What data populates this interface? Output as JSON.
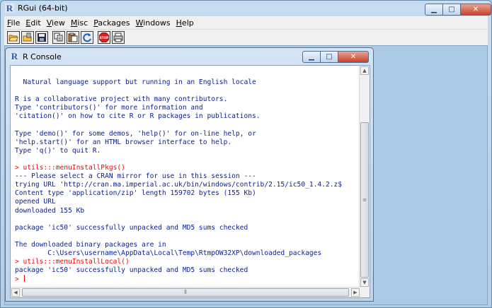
{
  "app": {
    "title": "RGui (64-bit)",
    "icon": "r-logo-icon",
    "brand_color": "#2a5fb0"
  },
  "menu": [
    {
      "label": "File",
      "mnemonic": "F",
      "rest": "ile"
    },
    {
      "label": "Edit",
      "mnemonic": "E",
      "rest": "dit"
    },
    {
      "label": "View",
      "mnemonic": "V",
      "rest": "iew"
    },
    {
      "label": "Misc",
      "mnemonic": "M",
      "rest": "isc"
    },
    {
      "label": "Packages",
      "mnemonic": "P",
      "rest": "ackages"
    },
    {
      "label": "Windows",
      "mnemonic": "W",
      "rest": "indows"
    },
    {
      "label": "Help",
      "mnemonic": "H",
      "rest": "elp"
    }
  ],
  "toolbar": [
    "open-script-icon",
    "load-workspace-icon",
    "save-workspace-icon",
    "copy-icon",
    "paste-icon",
    "copy-paste-icon",
    "stop-icon",
    "print-icon"
  ],
  "toolbar_stop_text": "STOP",
  "console": {
    "title": "R Console",
    "lines": [
      {
        "text": "",
        "cmd": false
      },
      {
        "text": "  Natural language support but running in an English locale",
        "cmd": false
      },
      {
        "text": "",
        "cmd": false
      },
      {
        "text": "R is a collaborative project with many contributors.",
        "cmd": false
      },
      {
        "text": "Type 'contributors()' for more information and",
        "cmd": false
      },
      {
        "text": "'citation()' on how to cite R or R packages in publications.",
        "cmd": false
      },
      {
        "text": "",
        "cmd": false
      },
      {
        "text": "Type 'demo()' for some demos, 'help()' for on-line help, or",
        "cmd": false
      },
      {
        "text": "'help.start()' for an HTML browser interface to help.",
        "cmd": false
      },
      {
        "text": "Type 'q()' to quit R.",
        "cmd": false
      },
      {
        "text": "",
        "cmd": false
      },
      {
        "text": "> utils:::menuInstallPkgs()",
        "cmd": true
      },
      {
        "text": "--- Please select a CRAN mirror for use in this session ---",
        "cmd": false
      },
      {
        "text": "trying URL 'http://cran.ma.imperial.ac.uk/bin/windows/contrib/2.15/ic50_1.4.2.z$",
        "cmd": false
      },
      {
        "text": "Content type 'application/zip' length 159702 bytes (155 Kb)",
        "cmd": false
      },
      {
        "text": "opened URL",
        "cmd": false
      },
      {
        "text": "downloaded 155 Kb",
        "cmd": false
      },
      {
        "text": "",
        "cmd": false
      },
      {
        "text": "package 'ic50' successfully unpacked and MD5 sums checked",
        "cmd": false
      },
      {
        "text": "",
        "cmd": false
      },
      {
        "text": "The downloaded binary packages are in",
        "cmd": false
      },
      {
        "text": "        C:\\Users\\username\\AppData\\Local\\Temp\\RtmpOW32XP\\downloaded_packages",
        "cmd": false
      },
      {
        "text": "> utils:::menuInstallLocal()",
        "cmd": true
      },
      {
        "text": "package 'ic50' successfully unpacked and MD5 sums checked",
        "cmd": false
      }
    ],
    "prompt": "> "
  },
  "window_buttons": {
    "minimize": "▁",
    "maximize": "□",
    "close": "✕"
  },
  "scroll": {
    "up": "▲",
    "down": "▼",
    "left": "◀",
    "right": "▶",
    "grip": "≡",
    "hgrip": "⦀"
  }
}
